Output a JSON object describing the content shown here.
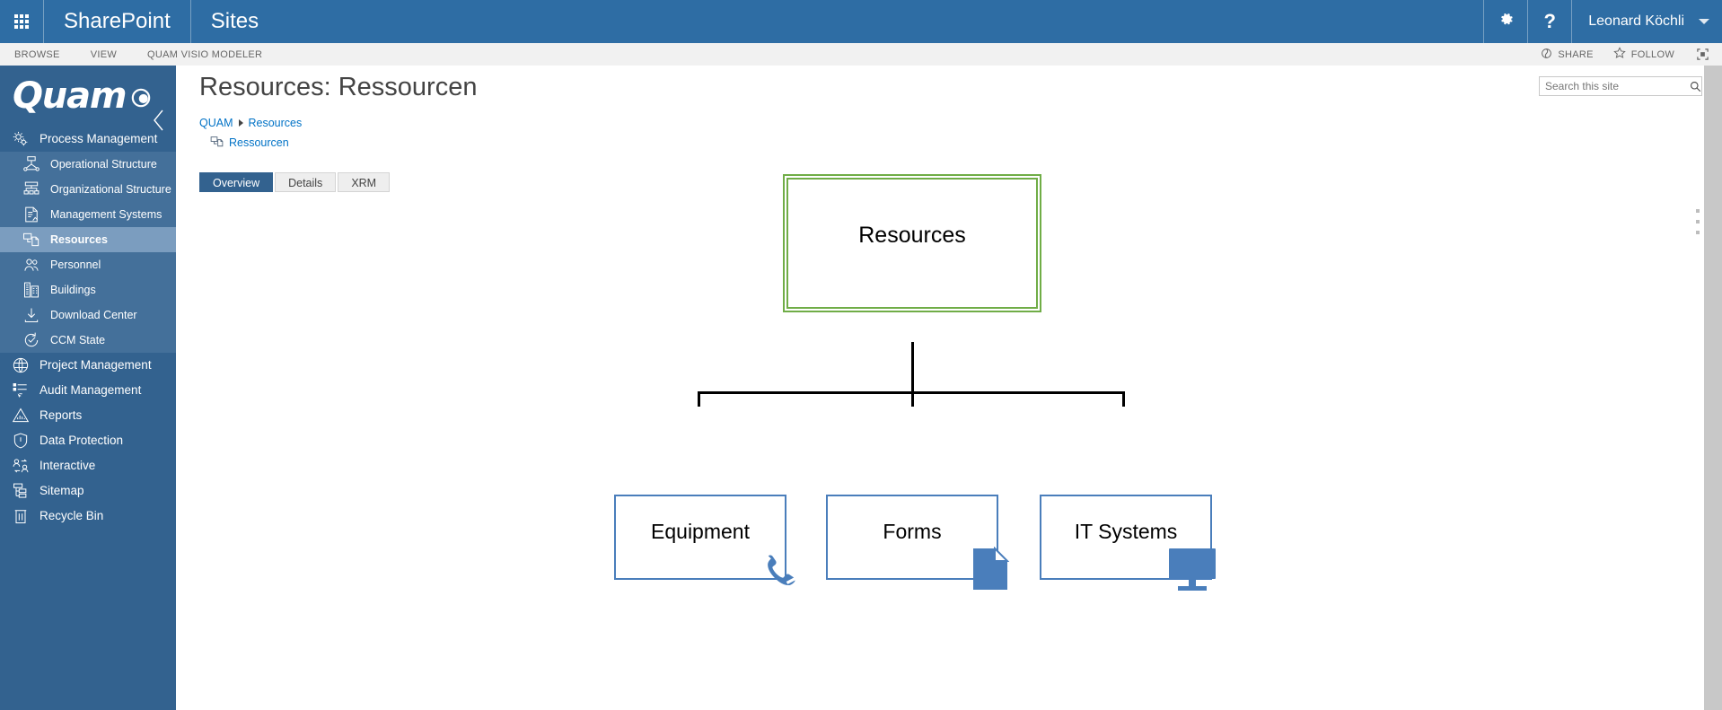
{
  "suite": {
    "waffle_icon": "waffle-grid-icon",
    "brand": "SharePoint",
    "site": "Sites",
    "settings_icon": "gear-icon",
    "help_icon": "help-icon",
    "user_name": "Leonard Köchli",
    "user_caret_icon": "chevron-down-icon"
  },
  "ribbon": {
    "tabs": [
      {
        "label": "BROWSE"
      },
      {
        "label": "VIEW"
      },
      {
        "label": "QUAM VISIO MODELER"
      }
    ],
    "actions": [
      {
        "label": "SHARE",
        "icon": "share-icon"
      },
      {
        "label": "FOLLOW",
        "icon": "star-icon"
      }
    ],
    "focus_icon": "focus-on-content-icon"
  },
  "sidebar": {
    "logo_text": "Quam",
    "logo_mark_icon": "quam-dot-icon",
    "collapse_icon": "chevron-left-icon",
    "items": [
      {
        "label": "Process Management",
        "icon": "gears-icon",
        "level": "top",
        "active": false
      },
      {
        "label": "Operational Structure",
        "icon": "operational-structure-icon",
        "level": "sub",
        "active": false
      },
      {
        "label": "Organizational Structure",
        "icon": "org-chart-icon",
        "level": "sub",
        "active": false
      },
      {
        "label": "Management Systems",
        "icon": "document-check-icon",
        "level": "sub",
        "active": false
      },
      {
        "label": "Resources",
        "icon": "resources-icon",
        "level": "sub",
        "active": true
      },
      {
        "label": "Personnel",
        "icon": "people-icon",
        "level": "sub",
        "active": false
      },
      {
        "label": "Buildings",
        "icon": "building-icon",
        "level": "sub",
        "active": false
      },
      {
        "label": "Download Center",
        "icon": "download-icon",
        "level": "sub",
        "active": false
      },
      {
        "label": "CCM State",
        "icon": "refresh-check-icon",
        "level": "sub",
        "active": false
      },
      {
        "label": "Project Management",
        "icon": "globe-icon",
        "level": "top",
        "active": false
      },
      {
        "label": "Audit Management",
        "icon": "checklist-cursor-icon",
        "level": "top",
        "active": false
      },
      {
        "label": "Reports",
        "icon": "chart-triangle-icon",
        "level": "top",
        "active": false
      },
      {
        "label": "Data Protection",
        "icon": "shield-alert-icon",
        "level": "top",
        "active": false
      },
      {
        "label": "Interactive",
        "icon": "people-exchange-icon",
        "level": "top",
        "active": false
      },
      {
        "label": "Sitemap",
        "icon": "sitemap-icon",
        "level": "top",
        "active": false
      },
      {
        "label": "Recycle Bin",
        "icon": "trash-icon",
        "level": "top",
        "active": false
      }
    ]
  },
  "search": {
    "placeholder": "Search this site",
    "value": "",
    "icon": "search-icon"
  },
  "page": {
    "title": "Resources: Ressourcen",
    "breadcrumb": [
      {
        "label": "QUAM"
      },
      {
        "label": "Resources"
      }
    ],
    "breadcrumb_item": {
      "label": "Ressourcen",
      "icon": "resources-icon"
    }
  },
  "tabs": [
    {
      "label": "Overview",
      "selected": true
    },
    {
      "label": "Details",
      "selected": false
    },
    {
      "label": "XRM",
      "selected": false
    }
  ],
  "chart_data": {
    "type": "diagram",
    "title": "Resources",
    "root": {
      "label": "Resources",
      "border_color": "#70ad47",
      "style": "double-border"
    },
    "children": [
      {
        "label": "Equipment",
        "border_color": "#4a7ebb",
        "badge_icon": "phone-icon",
        "badge_color": "#4a7ebb"
      },
      {
        "label": "Forms",
        "border_color": "#4a7ebb",
        "badge_icon": "document-icon",
        "badge_color": "#4a7ebb"
      },
      {
        "label": "IT Systems",
        "border_color": "#4a7ebb",
        "badge_icon": "monitor-icon",
        "badge_color": "#4a7ebb"
      }
    ],
    "connector_color": "#000000"
  },
  "colors": {
    "suite_bar": "#2e6da4",
    "sidebar": "#33628f",
    "sidebar_sub": "#44709a",
    "sidebar_active": "#7b9dbf",
    "accent_link": "#0072c6",
    "node_root_border": "#70ad47",
    "node_child_border": "#4a7ebb"
  }
}
